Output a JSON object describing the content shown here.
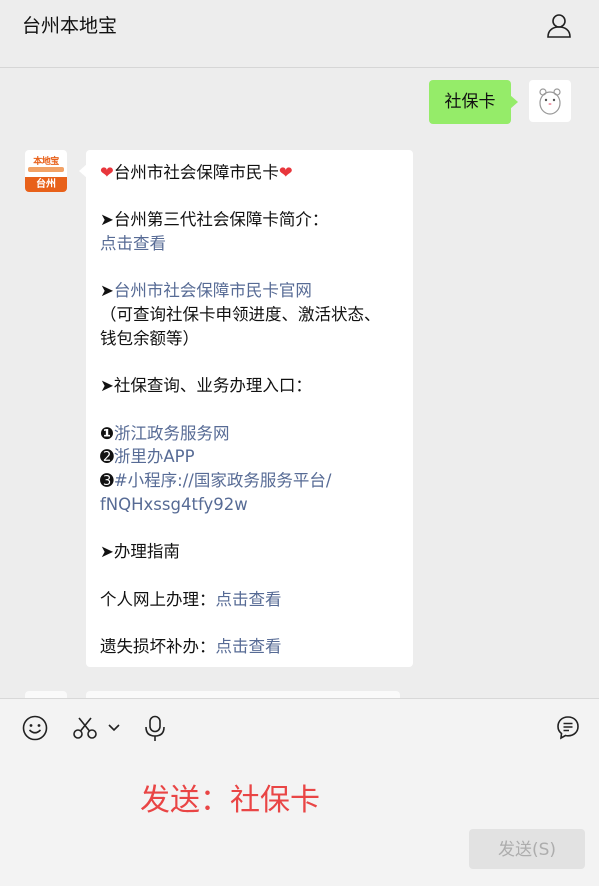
{
  "header": {
    "title": "台州本地宝",
    "user_icon": "user-icon"
  },
  "chat": {
    "outgoing": {
      "text": "社保卡"
    },
    "bot_avatar": {
      "logo_top": "本地宝",
      "logo_bottom": "台州"
    },
    "incoming": {
      "title": "台州市社会保障市民卡",
      "section1_label": "➤台州第三代社会保障卡简介：",
      "section1_link": "点击查看",
      "section2_arrow": "➤",
      "section2_link": "台州市社会保障市民卡官网",
      "section2_note_1": "（可查询社保卡申领进度、激活状态、",
      "section2_note_2": "钱包余额等）",
      "section3_label": "➤社保查询、业务办理入口：",
      "item1_num": "❶",
      "item1_link": "浙江政务服务网",
      "item2_num": "➋",
      "item2_link": "浙里办APP",
      "item3_num": "➌",
      "item3_link_1": "#小程序://国家政务服务平台/",
      "item3_link_2": "fNQHxssg4tfy92w",
      "section4_label": "➤办理指南",
      "guide1_label": "个人网上办理：",
      "guide1_link": "点击查看",
      "guide2_label": "遗失损坏补办：",
      "guide2_link": "点击查看"
    }
  },
  "input": {
    "composer_text": "发送：社保卡",
    "send_label": "发送(S)"
  },
  "colors": {
    "outgoing_bubble": "#95ec69",
    "link": "#576b95",
    "composer_text": "#e94545"
  }
}
